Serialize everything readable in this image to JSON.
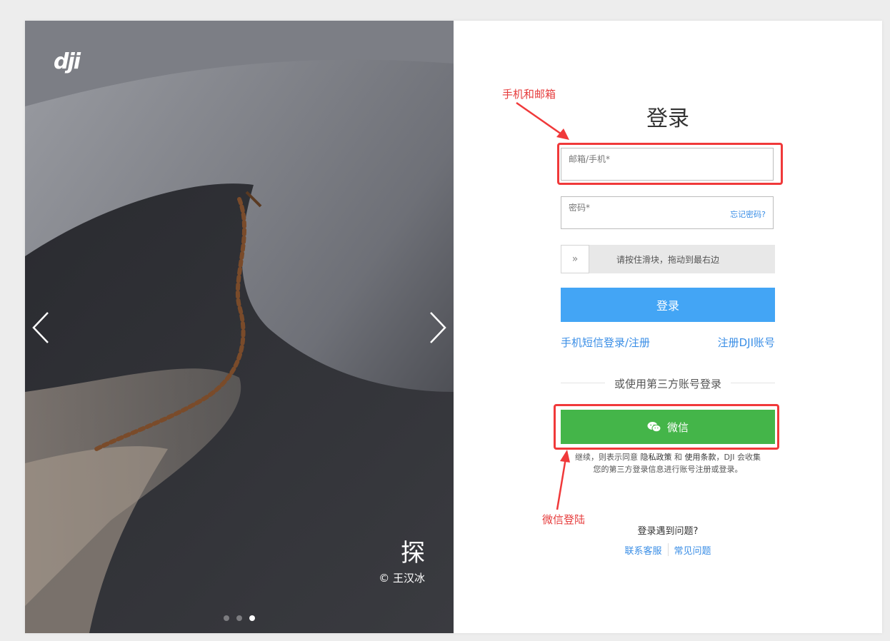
{
  "hero": {
    "logo": "dji",
    "caption_title": "探",
    "caption_credit": "© 王汉冰",
    "dots_count": 3,
    "active_dot": 3
  },
  "form": {
    "title": "登录",
    "email": {
      "label": "邮箱/手机*",
      "value": ""
    },
    "password": {
      "label": "密码*",
      "value": ""
    },
    "forgot_link": "忘记密码?",
    "slider": {
      "handle": "»",
      "text": "请按住滑块，拖动到最右边"
    },
    "login_button": "登录",
    "sms_link": "手机短信登录/注册",
    "register_link": "注册DJI账号",
    "divider_text": "或使用第三方账号登录",
    "wechat_button": "微信",
    "terms": {
      "part1": "继续，则表示同意 ",
      "privacy": "隐私政策",
      "and": " 和 ",
      "usage": "使用条款",
      "part2": "，DJI 会收集",
      "line2": "您的第三方登录信息进行账号注册或登录。"
    },
    "help_title": "登录遇到问题?",
    "help_contact": "联系客服",
    "help_faq": "常见问题"
  },
  "annotations": {
    "phone_email": "手机和邮箱",
    "wechat_login": "微信登陆"
  },
  "colors": {
    "primary_blue": "#43a5f5",
    "link_blue": "#3a8ee6",
    "wechat_green": "#44b549",
    "annotation_red": "#f0393a"
  }
}
